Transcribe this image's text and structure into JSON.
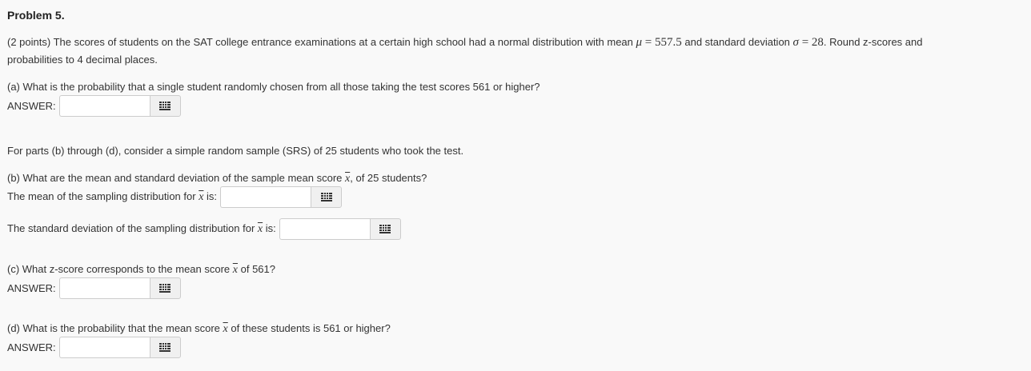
{
  "problem": {
    "title": "Problem 5.",
    "intro_part1": "(2 points) The scores of students on the SAT college entrance examinations at a certain high school had a normal distribution with mean ",
    "mu_symbol": "μ",
    "equals": " = ",
    "mu_value": "557.5",
    "intro_part2": " and standard deviation ",
    "sigma_symbol": "σ",
    "sigma_value": "28",
    "intro_part3": ". Round z-scores and",
    "intro_line2": "probabilities to 4 decimal places."
  },
  "part_a": {
    "question": "(a) What is the probability that a single student randomly chosen from all those taking the test scores 561 or higher?",
    "answer_label": "ANSWER:",
    "answer_value": ""
  },
  "srs_note": "For parts (b) through (d), consider a simple random sample (SRS) of 25 students who took the test.",
  "xbar_symbol": "x",
  "part_b": {
    "question_pre": "(b) What are the mean and standard deviation of the sample mean score ",
    "question_post": ", of 25 students?",
    "mean_label_pre": "The mean of the sampling distribution for ",
    "mean_label_post": " is:",
    "mean_value": "",
    "sd_label_pre": "The standard deviation of the sampling distribution for ",
    "sd_label_post": " is:",
    "sd_value": ""
  },
  "part_c": {
    "question_pre": "(c) What z-score corresponds to the mean score ",
    "question_post": " of 561?",
    "answer_label": "ANSWER:",
    "answer_value": ""
  },
  "part_d": {
    "question_pre": "(d) What is the probability that the mean score ",
    "question_post": " of these students is 561 or higher?",
    "answer_label": "ANSWER:",
    "answer_value": ""
  },
  "icons": {
    "keypad": "keypad-grid-icon"
  },
  "colors": {
    "background": "#f9f9f9",
    "text": "#333333",
    "field_border": "#cccccc",
    "button_bg": "#f0f0f0",
    "icon": "#333333"
  }
}
